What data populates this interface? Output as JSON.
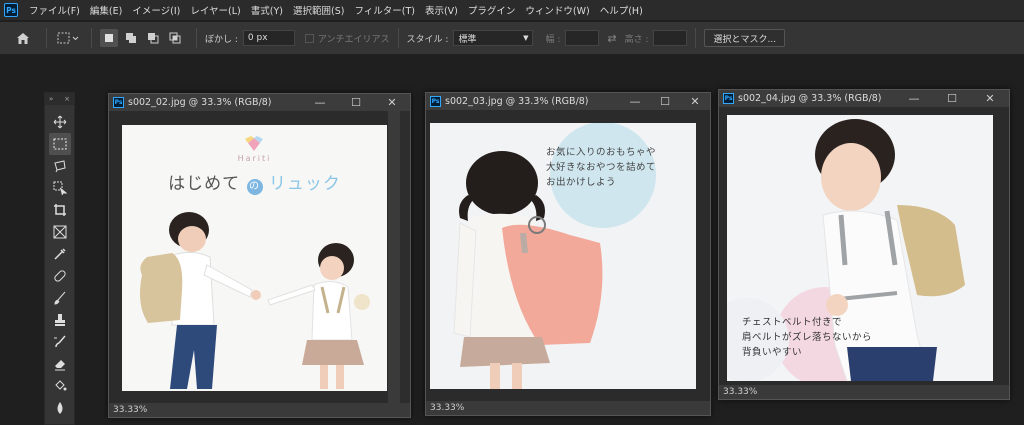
{
  "app": {
    "logo_text": "Ps"
  },
  "menu": [
    "ファイル(F)",
    "編集(E)",
    "イメージ(I)",
    "レイヤー(L)",
    "書式(Y)",
    "選択範囲(S)",
    "フィルター(T)",
    "表示(V)",
    "プラグイン",
    "ウィンドウ(W)",
    "ヘルプ(H)"
  ],
  "options": {
    "feather_label": "ぼかし :",
    "feather_value": "0 px",
    "antialias_label": "アンチエイリアス",
    "style_label": "スタイル :",
    "style_value": "標準",
    "width_label": "幅 :",
    "height_label": "高さ :",
    "select_mask_label": "選択とマスク..."
  },
  "toolbar": {
    "collapse": "»",
    "close": "×"
  },
  "documents": [
    {
      "title": "s002_02.jpg @ 33.3% (RGB/8)",
      "zoom": "33.33%",
      "logo_brand": "Hariti",
      "headline_parts": [
        "はじめての",
        "の",
        "リュック"
      ],
      "headline": "はじめて",
      "headline_no": "の",
      "headline_tail": "リュック"
    },
    {
      "title": "s002_03.jpg @ 33.3% (RGB/8)",
      "zoom": "33.33%",
      "copy": [
        "お気に入りのおもちゃや",
        "大好きなおやつを詰めて",
        "お出かけしよう"
      ]
    },
    {
      "title": "s002_04.jpg @ 33.3% (RGB/8)",
      "zoom": "33.33%",
      "copy": [
        "チェストベルト付きで",
        "肩ベルトがズレ落ちないから",
        "背負いやすい"
      ]
    }
  ],
  "window_controls": {
    "minimize": "—",
    "maximize": "☐",
    "close": "✕"
  },
  "colors": {
    "accent": "#31a8ff",
    "workspace": "#1f1f1f",
    "panel": "#353535"
  }
}
